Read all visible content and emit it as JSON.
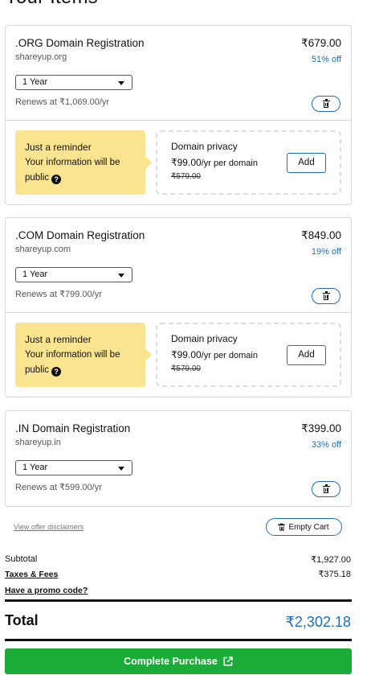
{
  "page": {
    "title": "Your Items"
  },
  "items": [
    {
      "name": ".ORG Domain Registration",
      "domain": "shareyup.org",
      "price": "₹679.00",
      "discount": "51% off",
      "term": "1 Year",
      "renews": "Renews at ₹1,069.00/yr",
      "upsell": {
        "reminder_title": "Just a reminder",
        "reminder_text": "Your information will be public",
        "privacy_title": "Domain privacy",
        "privacy_price": "₹99.00",
        "privacy_unit": "/yr per domain",
        "privacy_old_price": "₹579.00",
        "add_label": "Add"
      }
    },
    {
      "name": ".COM Domain Registration",
      "domain": "shareyup.com",
      "price": "₹849.00",
      "discount": "19% off",
      "term": "1 Year",
      "renews": "Renews at ₹799.00/yr",
      "upsell": {
        "reminder_title": "Just a reminder",
        "reminder_text": "Your information will be public",
        "privacy_title": "Domain privacy",
        "privacy_price": "₹99.00",
        "privacy_unit": "/yr per domain",
        "privacy_old_price": "₹579.00",
        "add_label": "Add"
      }
    },
    {
      "name": ".IN Domain Registration",
      "domain": "shareyup.in",
      "price": "₹399.00",
      "discount": "33% off",
      "term": "1 Year",
      "renews": "Renews at ₹599.00/yr"
    }
  ],
  "actions": {
    "disclaimers_label": "View offer disclaimers",
    "empty_cart_label": "Empty Cart"
  },
  "summary": {
    "subtotal_label": "Subtotal",
    "subtotal_value": "₹1,927.00",
    "taxes_label": "Taxes & Fees",
    "taxes_value": "₹375.18",
    "promo_label": "Have a promo code?",
    "total_label": "Total",
    "total_value": "₹2,302.18"
  },
  "checkout": {
    "button_label": "Complete Purchase"
  },
  "icons": {
    "remove": "trash-icon",
    "help": "question-circle-icon",
    "dropdown": "chevron-down-icon",
    "external": "external-link-icon"
  },
  "colors": {
    "accent_blue": "#1c6fc4",
    "purchase_green": "#1bab38",
    "reminder_yellow": "#fbe48f"
  }
}
